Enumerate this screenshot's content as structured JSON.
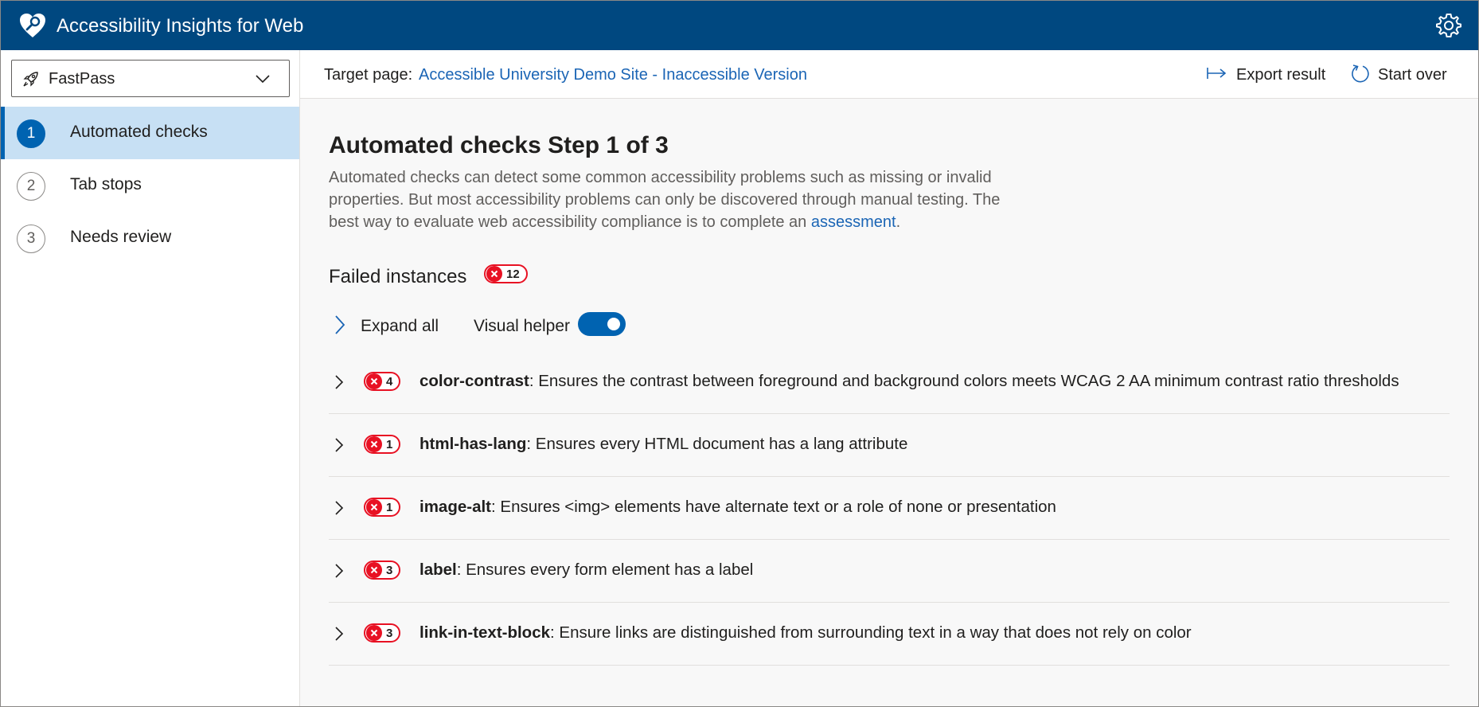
{
  "app": {
    "title": "Accessibility Insights for Web"
  },
  "icons": {
    "logo": "heart-logo-icon",
    "settings": "gear-icon",
    "mode": "rocket-icon",
    "dropdown": "chevron-down-icon",
    "export": "export-arrow-icon",
    "startover": "refresh-icon",
    "expand": "chevron-right-icon",
    "error": "error-x-icon"
  },
  "colors": {
    "header": "#004880",
    "accent": "#0063b1",
    "link": "#1b65b5",
    "error": "#e81123",
    "nav_active": "#c7e0f4"
  },
  "mode_select": {
    "value": "FastPass"
  },
  "nav": [
    {
      "num": "1",
      "label": "Automated checks",
      "active": true
    },
    {
      "num": "2",
      "label": "Tab stops",
      "active": false
    },
    {
      "num": "3",
      "label": "Needs review",
      "active": false
    }
  ],
  "command_bar": {
    "target_label": "Target page:",
    "target_link": "Accessible University Demo Site - Inaccessible Version",
    "export_label": "Export result",
    "startover_label": "Start over"
  },
  "main": {
    "heading": "Automated checks Step 1 of 3",
    "description_text": "Automated checks can detect some common accessibility problems such as missing or invalid properties. But most accessibility problems can only be discovered through manual testing. The best way to evaluate web accessibility compliance is to complete an ",
    "description_link": "assessment",
    "description_end": ".",
    "failed_heading": "Failed instances",
    "failed_count": "12",
    "expand_all_label": "Expand all",
    "visual_helper_label": "Visual helper",
    "visual_helper_on": true
  },
  "rules": [
    {
      "count": "4",
      "id": "color-contrast",
      "description": ": Ensures the contrast between foreground and background colors meets WCAG 2 AA minimum contrast ratio thresholds"
    },
    {
      "count": "1",
      "id": "html-has-lang",
      "description": ": Ensures every HTML document has a lang attribute"
    },
    {
      "count": "1",
      "id": "image-alt",
      "description": ": Ensures <img> elements have alternate text or a role of none or presentation"
    },
    {
      "count": "3",
      "id": "label",
      "description": ": Ensures every form element has a label"
    },
    {
      "count": "3",
      "id": "link-in-text-block",
      "description": ": Ensure links are distinguished from surrounding text in a way that does not rely on color"
    }
  ]
}
